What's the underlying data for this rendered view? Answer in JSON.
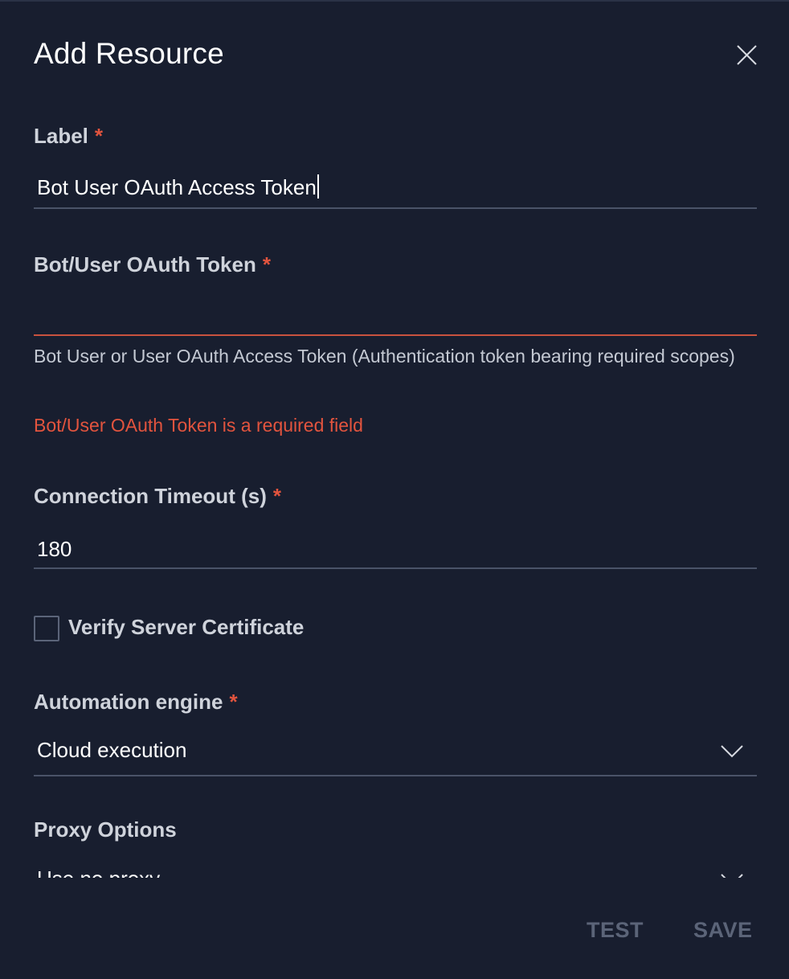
{
  "dialog": {
    "title": "Add Resource",
    "close_icon": "close-icon"
  },
  "fields": {
    "label": {
      "label": "Label",
      "required": "*",
      "value": "Bot User OAuth Access Token"
    },
    "token": {
      "label": "Bot/User OAuth Token",
      "required": "*",
      "value": "",
      "help": "Bot User or User OAuth Access Token (Authentication token bearing required scopes)",
      "error": "Bot/User OAuth Token is a required field"
    },
    "timeout": {
      "label": "Connection Timeout (s)",
      "required": "*",
      "value": "180"
    },
    "verify_cert": {
      "label": "Verify Server Certificate",
      "checked": false
    },
    "engine": {
      "label": "Automation engine",
      "required": "*",
      "value": "Cloud execution",
      "icon": "chevron-down-icon"
    },
    "proxy": {
      "label": "Proxy Options",
      "value": "Use no proxy",
      "icon": "chevron-down-icon"
    }
  },
  "footer": {
    "test_label": "TEST",
    "save_label": "SAVE"
  },
  "colors": {
    "background": "#181e2f",
    "error": "#e2543e",
    "disabled_button": "#5b6478"
  }
}
